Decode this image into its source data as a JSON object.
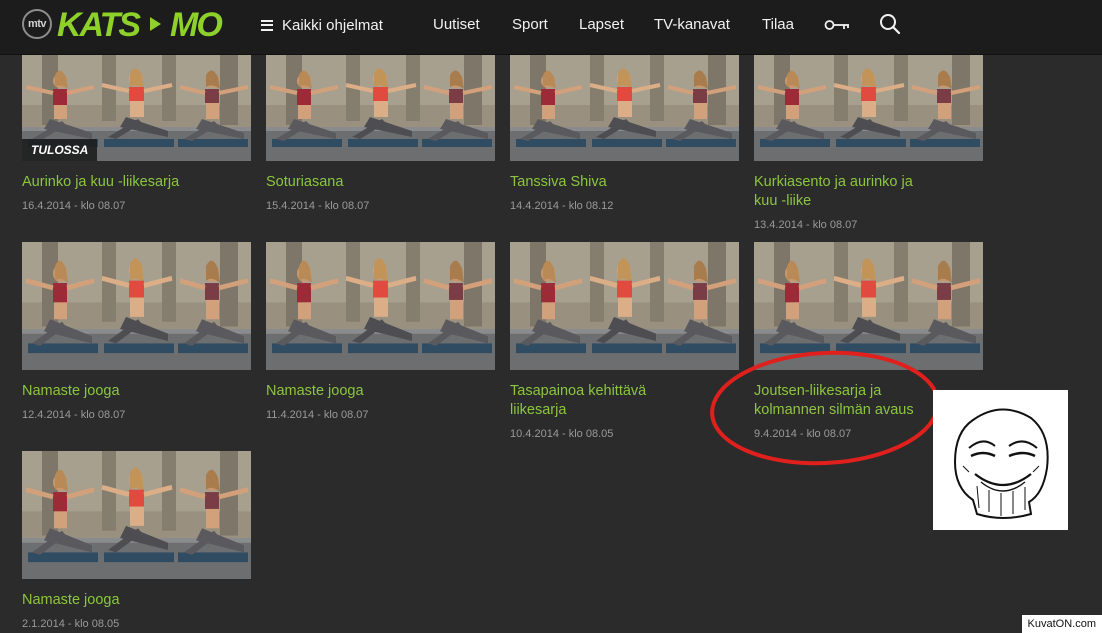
{
  "brand": {
    "badge": "mtv",
    "part1": "KATS",
    "part2": "MO",
    "color": "#8fd12b"
  },
  "nav": {
    "all_programs": "Kaikki ohjelmat",
    "links": [
      "Uutiset",
      "Sport",
      "Lapset",
      "TV-kanavat",
      "Tilaa"
    ],
    "icons": [
      "menu-icon",
      "key-icon",
      "search-icon"
    ]
  },
  "cards": [
    {
      "title_lines": [
        "Aurinko ja kuu -liikesarja"
      ],
      "date": "16.4.2014 - klo 08.07",
      "badge": "TULOSSA"
    },
    {
      "title_lines": [
        "Soturiasana"
      ],
      "date": "15.4.2014 - klo 08.07"
    },
    {
      "title_lines": [
        "Tanssiva Shiva"
      ],
      "date": "14.4.2014 - klo 08.12"
    },
    {
      "title_lines": [
        "Kurkiasento ja aurinko ja",
        "kuu -liike"
      ],
      "date": "13.4.2014 - klo 08.07"
    },
    {
      "title_lines": [
        "Namaste jooga"
      ],
      "date": "12.4.2014 - klo 08.07"
    },
    {
      "title_lines": [
        "Namaste jooga"
      ],
      "date": "11.4.2014 - klo 08.07"
    },
    {
      "title_lines": [
        "Tasapainoa kehittävä",
        "liikesarja"
      ],
      "date": "10.4.2014 - klo 08.05"
    },
    {
      "title_lines": [
        "Joutsen-liikesarja ja",
        "kolmannen silmän avaus"
      ],
      "date": "9.4.2014 - klo 08.07"
    },
    {
      "title_lines": [
        "Namaste jooga"
      ],
      "date": "2.1.2014 - klo 08.05"
    }
  ],
  "annotation": {
    "circle_color": "#e0201c"
  },
  "watermark": "KuvatON.com",
  "colors": {
    "background": "#2b2b2b",
    "topbar": "#1c1c1c",
    "title": "#8cc63f",
    "date": "#9a9a9a"
  }
}
